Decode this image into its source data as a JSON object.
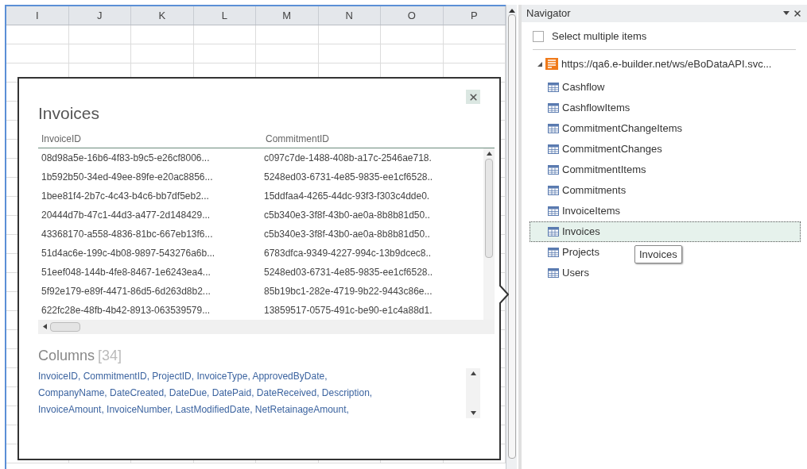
{
  "spreadsheet": {
    "columns": [
      "I",
      "J",
      "K",
      "L",
      "M",
      "N",
      "O",
      "P"
    ]
  },
  "preview": {
    "title": "Invoices",
    "table": {
      "columns": [
        "InvoiceID",
        "CommitmentID"
      ],
      "rows": [
        [
          "08d98a5e-16b6-4f83-b9c5-e26cf8006...",
          "c097c7de-1488-408b-a17c-2546ae718."
        ],
        [
          "1b592b50-34ed-49ee-89fe-e20ac8856...",
          "5248ed03-6731-4e85-9835-ee1cf6528.."
        ],
        [
          "1bee81f4-2b7c-4c43-b4c6-bb7df5eb2...",
          "15ddfaa4-4265-44dc-93f3-f303c4dde0."
        ],
        [
          "20444d7b-47c1-44d3-a477-2d148429...",
          "c5b340e3-3f8f-43b0-ae0a-8b8b81d50.."
        ],
        [
          "43368170-a558-4836-81bc-667eb13f6...",
          "c5b340e3-3f8f-43b0-ae0a-8b8b81d50.."
        ],
        [
          "51d4ac6e-199c-4b08-9897-543276a6b...",
          "6783dfca-9349-4227-994c-13b9dcec8.."
        ],
        [
          "51eef048-144b-4fe8-8467-1e6243ea4...",
          "5248ed03-6731-4e85-9835-ee1cf6528.."
        ],
        [
          "5f92e179-e89f-4471-86d5-6d263d8b2...",
          "85b19bc1-282e-4719-9b22-9443c86e..."
        ],
        [
          "622fc28e-48fb-4b42-8913-063539579...",
          "13859517-0575-491c-be90-e1c4a88d1."
        ]
      ]
    },
    "columns_heading": "Columns",
    "columns_count": "[34]",
    "columns_lines": [
      "InvoiceID, CommitmentID, ProjectID, InvoiceType, ApprovedByDate,",
      "CompanyName, DateCreated, DateDue, DatePaid, DateReceived, Description,",
      "InvoiceAmount, InvoiceNumber, LastModifiedDate, NetRetainageAmount,"
    ]
  },
  "navigator": {
    "title": "Navigator",
    "select_multiple": {
      "label": "Select multiple items",
      "checked": false
    },
    "source": {
      "label": "https://qa6.e-builder.net/ws/eBoDataAPI.svc...",
      "expanded": true,
      "children": [
        {
          "label": "Cashflow",
          "selected": false
        },
        {
          "label": "CashflowItems",
          "selected": false
        },
        {
          "label": "CommitmentChangeItems",
          "selected": false
        },
        {
          "label": "CommitmentChanges",
          "selected": false
        },
        {
          "label": "CommitmentItems",
          "selected": false
        },
        {
          "label": "Commitments",
          "selected": false
        },
        {
          "label": "InvoiceItems",
          "selected": false
        },
        {
          "label": "Invoices",
          "selected": true
        },
        {
          "label": "Projects",
          "selected": false
        },
        {
          "label": "Users",
          "selected": false
        }
      ]
    },
    "tooltip": "Invoices"
  }
}
